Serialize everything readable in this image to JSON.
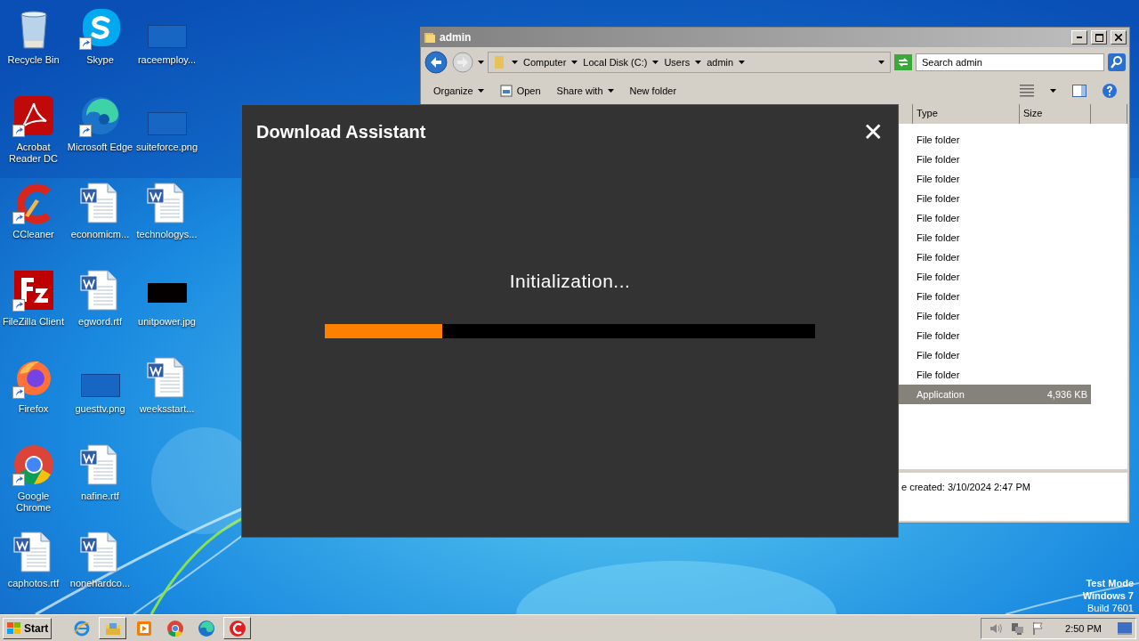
{
  "desktop": {
    "icons": [
      {
        "label": "Recycle Bin",
        "kind": "recycle",
        "shortcut": false
      },
      {
        "label": "Acrobat Reader DC",
        "kind": "acrobat",
        "shortcut": true
      },
      {
        "label": "CCleaner",
        "kind": "ccleaner",
        "shortcut": true
      },
      {
        "label": "FileZilla Client",
        "kind": "filezilla",
        "shortcut": true
      },
      {
        "label": "Firefox",
        "kind": "firefox",
        "shortcut": true
      },
      {
        "label": "Google Chrome",
        "kind": "chrome",
        "shortcut": true
      },
      {
        "label": "caphotos.rtf",
        "kind": "word",
        "shortcut": false
      },
      {
        "label": "Skype",
        "kind": "skype",
        "shortcut": true
      },
      {
        "label": "Microsoft Edge",
        "kind": "edge",
        "shortcut": true
      },
      {
        "label": "economicm...",
        "kind": "word",
        "shortcut": false
      },
      {
        "label": "egword.rtf",
        "kind": "word",
        "shortcut": false
      },
      {
        "label": "guesttv.png",
        "kind": "blank",
        "shortcut": false
      },
      {
        "label": "nafine.rtf",
        "kind": "word",
        "shortcut": false
      },
      {
        "label": "nonehardco...",
        "kind": "word",
        "shortcut": false
      },
      {
        "label": "raceemploy...",
        "kind": "blank",
        "shortcut": false
      },
      {
        "label": "suiteforce.png",
        "kind": "blank",
        "shortcut": false
      },
      {
        "label": "technologys...",
        "kind": "word",
        "shortcut": false
      },
      {
        "label": "unitpower.jpg",
        "kind": "dark",
        "shortcut": false
      },
      {
        "label": "weeksstart...",
        "kind": "word",
        "shortcut": false
      }
    ],
    "system_text": [
      "Test Mode",
      "Windows 7",
      "Build 7601"
    ]
  },
  "explorer": {
    "title": "admin",
    "breadcrumbs": [
      "Computer",
      "Local Disk (C:)",
      "Users",
      "admin"
    ],
    "search": {
      "placeholder": "Search admin"
    },
    "toolbar": [
      {
        "label": "Organize",
        "kind": "menu"
      },
      {
        "label": "Open",
        "kind": "open"
      },
      {
        "label": "Share with",
        "kind": "menu"
      },
      {
        "label": "New folder",
        "kind": "plain"
      }
    ],
    "columns": [
      "Type",
      "Size"
    ],
    "rows": [
      {
        "type": "File folder",
        "selected": false
      },
      {
        "type": "File folder",
        "selected": false
      },
      {
        "type": "File folder",
        "selected": false
      },
      {
        "type": "File folder",
        "selected": false
      },
      {
        "type": "File folder",
        "selected": false
      },
      {
        "type": "File folder",
        "selected": false
      },
      {
        "type": "File folder",
        "selected": false
      },
      {
        "type": "File folder",
        "selected": false
      },
      {
        "type": "File folder",
        "selected": false
      },
      {
        "type": "File folder",
        "selected": false
      },
      {
        "type": "File folder",
        "selected": false
      },
      {
        "type": "File folder",
        "selected": false
      },
      {
        "type": "File folder",
        "selected": false
      },
      {
        "type": "Application",
        "size": "4,936 KB",
        "selected": true
      }
    ],
    "details": "e created: 3/10/2024 2:47 PM"
  },
  "dialog": {
    "title": "Download Assistant",
    "close": "✕",
    "status": "Initialization...",
    "progress": {
      "level": 0.24
    }
  },
  "taskbar": {
    "start": "Start",
    "apps": [
      {
        "kind": "ie",
        "running": false
      },
      {
        "kind": "explorer",
        "running": true
      },
      {
        "kind": "media",
        "running": false
      },
      {
        "kind": "chrome",
        "running": false
      },
      {
        "kind": "edge",
        "running": false
      },
      {
        "kind": "ccleaner",
        "running": true
      }
    ],
    "clock": "2:50 PM"
  }
}
